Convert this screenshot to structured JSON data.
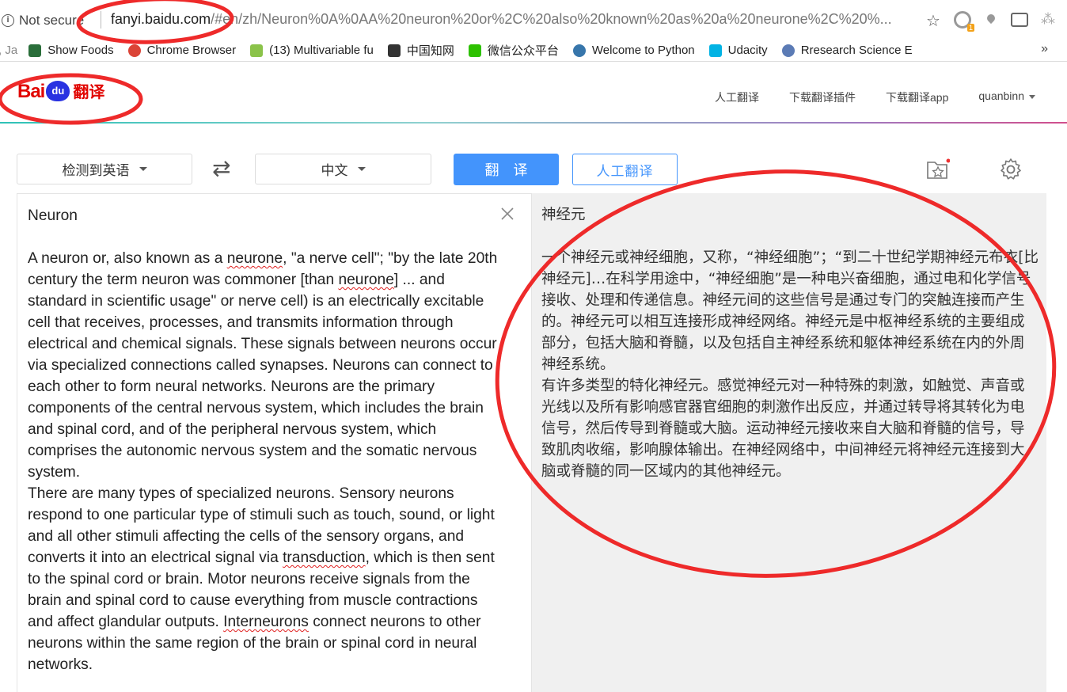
{
  "browser": {
    "security_label": "Not secure",
    "url_host": "fanyi.baidu.com",
    "url_path": "/#en/zh/Neuron%0A%0AA%20neuron%20or%2C%20also%20known%20as%20a%20neurone%2C%20%...",
    "ext_badge": "1",
    "bookmarks": [
      {
        "label": ", Ja",
        "icon": "partial-bookmark",
        "color": "#888888"
      },
      {
        "label": "Show Foods",
        "icon": "usda-icon",
        "color": "#2a6e3a"
      },
      {
        "label": "Chrome Browser",
        "icon": "chrome-icon",
        "color": "#db4437"
      },
      {
        "label": "(13) Multivariable fu",
        "icon": "leaf-icon",
        "color": "#8bc34a"
      },
      {
        "label": "中国知网",
        "icon": "cnki-icon",
        "color": "#333333"
      },
      {
        "label": "微信公众平台",
        "icon": "wechat-icon",
        "color": "#2dc100"
      },
      {
        "label": "Welcome to Python",
        "icon": "python-icon",
        "color": "#3776ab"
      },
      {
        "label": "Udacity",
        "icon": "udacity-icon",
        "color": "#02b3e4"
      },
      {
        "label": "Rresearch Science E",
        "icon": "research-icon",
        "color": "#5b7bb5"
      }
    ],
    "more_label": "»"
  },
  "header": {
    "logo_text_1": "Bai",
    "logo_text_2": "du",
    "logo_text_3": "翻译",
    "nav": [
      "人工翻译",
      "下载翻译插件",
      "下载翻译app",
      "quanbinn"
    ]
  },
  "toolbar": {
    "source_lang": "检测到英语",
    "swap_symbol": "⇄",
    "target_lang": "中文",
    "translate_label": "翻译",
    "human_label": "人工翻译"
  },
  "source": {
    "title": "Neuron",
    "p1a": "A neuron or, also known as a ",
    "w_neurone1": "neurone",
    "p1b": ", \"a nerve cell\"; \"by the late 20th century the term neuron was commoner [than ",
    "w_neurone2": "neurone",
    "p1c": "] ... and standard in scientific usage\" or nerve cell) is an electrically excitable cell that receives, processes, and transmits information through electrical and chemical signals. These signals between neurons occur via specialized connections called synapses. Neurons can connect to each other to form neural networks. Neurons are the primary components of the central nervous system, which includes the brain and spinal cord, and of the peripheral nervous system, which comprises the autonomic nervous system and the somatic nervous system.",
    "p2a": "There are many types of specialized neurons. Sensory neurons respond to one particular type of stimuli such as touch, sound, or light and all other stimuli affecting the cells of the sensory organs, and converts it into an electrical signal via ",
    "w_transduction": "transduction",
    "p2b": ", which is then sent to the spinal cord or brain. Motor neurons receive signals from the brain and spinal cord to cause everything from muscle contractions and affect glandular outputs. ",
    "w_interneurons": "Interneurons",
    "p2c": " connect neurons to other neurons within the same region of the brain or spinal cord in neural networks."
  },
  "target": {
    "title": "神经元",
    "p1": "一个神经元或神经细胞，又称，“神经细胞”；“到二十世纪学期神经元布衣[比神经元]…在科学用途中，“神经细胞”是一种电兴奋细胞，通过电和化学信号接收、处理和传递信息。神经元间的这些信号是通过专门的突触连接而产生的。神经元可以相互连接形成神经网络。神经元是中枢神经系统的主要组成部分，包括大脑和脊髓，以及包括自主神经系统和躯体神经系统在内的外周神经系统。",
    "p2": "有许多类型的特化神经元。感觉神经元对一种特殊的刺激，如触觉、声音或光线以及所有影响感官器官细胞的刺激作出反应，并通过转导将其转化为电信号，然后传导到脊髓或大脑。运动神经元接收来自大脑和脊髓的信号，导致肌肉收缩，影响腺体输出。在神经网络中，中间神经元将神经元连接到大脑或脊髓的同一区域内的其他神经元。"
  },
  "colors": {
    "brand_red": "#e10601",
    "brand_blue": "#2932e1",
    "button_blue": "#4394fc",
    "annotation_red": "#ee2a2a",
    "target_bg": "#f0f0f0"
  }
}
